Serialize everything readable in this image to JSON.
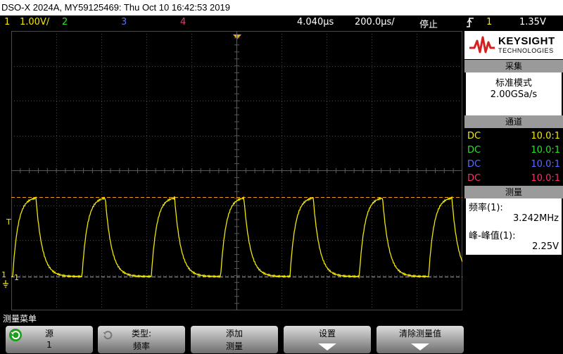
{
  "window": {
    "title": "DSO-X 2024A, MY59125469: Thu Oct 10 16:42:53 2019"
  },
  "status": {
    "ch1_label": "1",
    "ch1_scale": "1.00V/",
    "ch2_label": "2",
    "ch3_label": "3",
    "ch4_label": "4",
    "time_delay": "4.040μs",
    "time_scale": "200.0μs/",
    "run_state": "停止",
    "trigger_icon": "trigger-edge-icon",
    "trigger_source": "1",
    "trigger_level": "1.35V"
  },
  "screen": {
    "trigger_marker": "T",
    "ch1_ground_marker": "1",
    "ch1_cursor_label": "1"
  },
  "panel": {
    "brand_name": "KEYSIGHT",
    "brand_sub": "TECHNOLOGIES",
    "acquire": {
      "title": "采集",
      "mode": "标准模式",
      "rate": "2.00GSa/s"
    },
    "channels": {
      "title": "通道",
      "rows": [
        {
          "coupling": "DC",
          "probe": "10.0:1",
          "color": "#f2e60a"
        },
        {
          "coupling": "DC",
          "probe": "10.0:1",
          "color": "#2de02d"
        },
        {
          "coupling": "DC",
          "probe": "10.0:1",
          "color": "#5a6cff"
        },
        {
          "coupling": "DC",
          "probe": "10.0:1",
          "color": "#ff2d6a"
        }
      ]
    },
    "measure": {
      "title": "测量",
      "freq_label": "频率(1):",
      "freq_value": "3.242MHz",
      "pp_label": "峰-峰值(1):",
      "pp_value": "2.25V"
    }
  },
  "menu": {
    "title": "测量菜单",
    "keys": [
      {
        "line1": "源",
        "line2": "1",
        "icon": "rotate-knob-icon"
      },
      {
        "line1": "类型:",
        "line2": "频率",
        "icon": "rotate-knob-icon"
      },
      {
        "line1": "添加",
        "line2": "测量"
      },
      {
        "line1": "设置",
        "arrow": "down-arrow-icon"
      },
      {
        "line1": "清除测量值",
        "arrow": "down-arrow-icon"
      }
    ]
  },
  "colors": {
    "ch1": "#f2e60a",
    "ch2": "#2de02d",
    "ch3": "#5a6cff",
    "ch4": "#ff2d6a",
    "trigger_marker": "#f0a020",
    "grid": "#4a4a4a"
  }
}
